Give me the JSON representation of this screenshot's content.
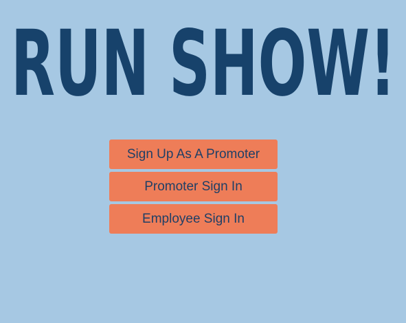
{
  "theme": {
    "background": "#a6c8e3",
    "title_color": "#17426b",
    "button_color": "#ee7d58",
    "button_text_color": "#1f3f66"
  },
  "header": {
    "title": "RUN SHOW!"
  },
  "actions": {
    "signup_promoter_label": "Sign Up As A Promoter",
    "promoter_signin_label": "Promoter Sign In",
    "employee_signin_label": "Employee Sign In"
  }
}
